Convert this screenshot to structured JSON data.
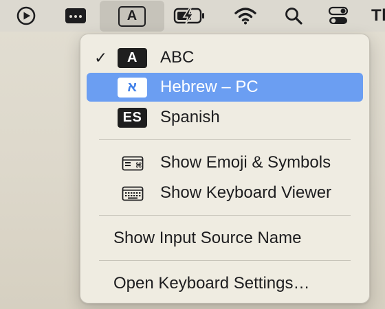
{
  "menubar": {
    "clipped_text": "Th",
    "input_source_letter": "A",
    "icons": [
      "play-circle-icon",
      "window-dots-icon",
      "input-source-icon",
      "battery-charging-icon",
      "wifi-icon",
      "search-icon",
      "control-center-icon"
    ]
  },
  "input_menu": {
    "sources": [
      {
        "badge": "A",
        "label": "ABC",
        "checked": true,
        "check_mark": "✓"
      },
      {
        "badge": "א",
        "label": "Hebrew – PC",
        "highlighted": true
      },
      {
        "badge": "ES",
        "label": "Spanish"
      }
    ],
    "emoji_label": "Show Emoji & Symbols",
    "keyboard_viewer_label": "Show Keyboard Viewer",
    "show_input_source_name_label": "Show Input Source Name",
    "open_settings_label": "Open Keyboard Settings…"
  },
  "colors": {
    "highlight": "#6b9ef2",
    "badge_bg": "#1e1e1e",
    "menu_bg": "#f0ece2"
  }
}
